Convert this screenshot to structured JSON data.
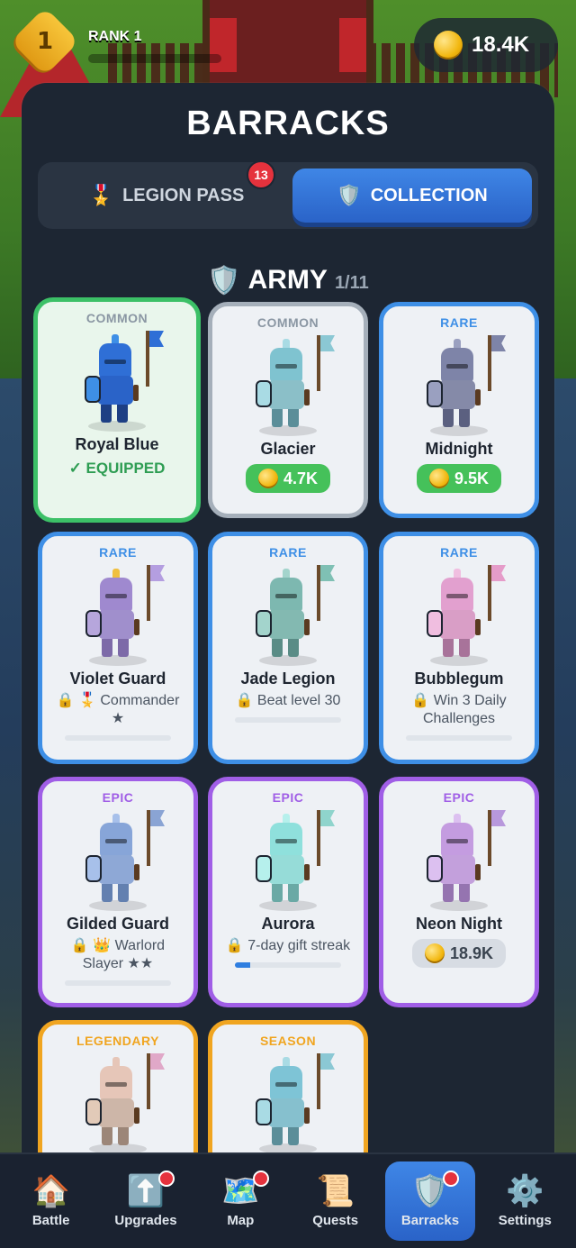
{
  "topbar": {
    "rank_number": "1",
    "rank_label": "RANK 1",
    "coins": "18.4K"
  },
  "panel": {
    "title": "BARRACKS"
  },
  "tabs": {
    "legion_pass": {
      "icon": "🎖️",
      "label": "LEGION PASS",
      "badge": "13"
    },
    "collection": {
      "icon": "🛡️",
      "label": "COLLECTION"
    }
  },
  "army": {
    "icon": "🛡️",
    "title": "ARMY",
    "count": "1/11"
  },
  "cards": [
    {
      "rarity": "COMMON",
      "name": "Royal Blue",
      "status": "✓ EQUIPPED",
      "colors": {
        "helm": "#2f6fd6",
        "body": "#2a63c8",
        "leg": "#1d3f84",
        "shield": "#3e8fe6",
        "flag": "#2f6fd6",
        "plume": "#3e8fe6"
      }
    },
    {
      "rarity": "COMMON",
      "name": "Glacier",
      "price": "4.7K",
      "colors": {
        "helm": "#7fc3d0",
        "body": "#8bbfc8",
        "leg": "#5b8e99",
        "shield": "#a9dbe4",
        "flag": "#8bc8d4",
        "plume": "#a9dbe4"
      }
    },
    {
      "rarity": "RARE",
      "name": "Midnight",
      "price": "9.5K",
      "colors": {
        "helm": "#7e84a8",
        "body": "#858aa8",
        "leg": "#5b6080",
        "shield": "#9aa0c0",
        "flag": "#7e84a8",
        "plume": "#9aa0c0"
      }
    },
    {
      "rarity": "RARE",
      "name": "Violet Guard",
      "lock": "🔒 🎖️",
      "requirement": "Commander ★",
      "colors": {
        "helm": "#9f89cf",
        "body": "#a08fcc",
        "leg": "#7d6aa8",
        "shield": "#b6a6dc",
        "flag": "#b49ee0",
        "plume": "#f0c040"
      }
    },
    {
      "rarity": "RARE",
      "name": "Jade Legion",
      "lock": "🔒",
      "requirement": "Beat level 30",
      "colors": {
        "helm": "#7db8b0",
        "body": "#83b9b1",
        "leg": "#5a8c86",
        "shield": "#a3d4cc",
        "flag": "#7fc0b4",
        "plume": "#a3d4cc"
      }
    },
    {
      "rarity": "RARE",
      "name": "Bubblegum",
      "lock": "🔒",
      "requirement": "Win 3 Daily Challenges",
      "colors": {
        "helm": "#e2a0cf",
        "body": "#d99ec6",
        "leg": "#a8739a",
        "shield": "#f0bee0",
        "flag": "#e59cc9",
        "plume": "#f0bee0"
      }
    },
    {
      "rarity": "EPIC",
      "name": "Gilded Guard",
      "lock": "🔒 👑",
      "requirement": "Warlord Slayer ★★",
      "colors": {
        "helm": "#87a5d8",
        "body": "#8ea8d6",
        "leg": "#6380b0",
        "shield": "#a7c0ea",
        "flag": "#8aa4d4",
        "plume": "#a7c0ea"
      }
    },
    {
      "rarity": "EPIC",
      "name": "Aurora",
      "lock": "🔒",
      "requirement": "7-day gift streak",
      "progress": 0.14,
      "colors": {
        "helm": "#8fe0dc",
        "body": "#96dcd8",
        "leg": "#6aa9a5",
        "shield": "#b6f0ec",
        "flag": "#8fd4cc",
        "plume": "#b6f0ec"
      }
    },
    {
      "rarity": "EPIC",
      "name": "Neon Night",
      "price": "18.9K",
      "price_style": "gray",
      "colors": {
        "helm": "#c49ce0",
        "body": "#c3a0dc",
        "leg": "#9574b0",
        "shield": "#dcc0f0",
        "flag": "#b898dc",
        "plume": "#dcc0f0"
      }
    },
    {
      "rarity": "LEGENDARY",
      "name": "",
      "colors": {
        "helm": "#e6c6b8",
        "body": "#cdb6a8",
        "leg": "#9c8678",
        "shield": "#e2cab8",
        "flag": "#e0a8c8",
        "plume": "#e6c6b8"
      }
    },
    {
      "rarity": "SEASON",
      "name": "",
      "colors": {
        "helm": "#7ec4d6",
        "body": "#86c0ce",
        "leg": "#5b8e99",
        "shield": "#a9dbe4",
        "flag": "#8bc8d4",
        "plume": "#a9dbe4"
      }
    }
  ],
  "nav": [
    {
      "icon": "🏠",
      "label": "Battle",
      "dot": false
    },
    {
      "icon": "⬆️",
      "label": "Upgrades",
      "dot": true
    },
    {
      "icon": "🗺️",
      "label": "Map",
      "dot": true
    },
    {
      "icon": "📜",
      "label": "Quests",
      "dot": false
    },
    {
      "icon": "🛡️",
      "label": "Barracks",
      "dot": true,
      "active": true
    },
    {
      "icon": "⚙️",
      "label": "Settings",
      "dot": false
    }
  ]
}
